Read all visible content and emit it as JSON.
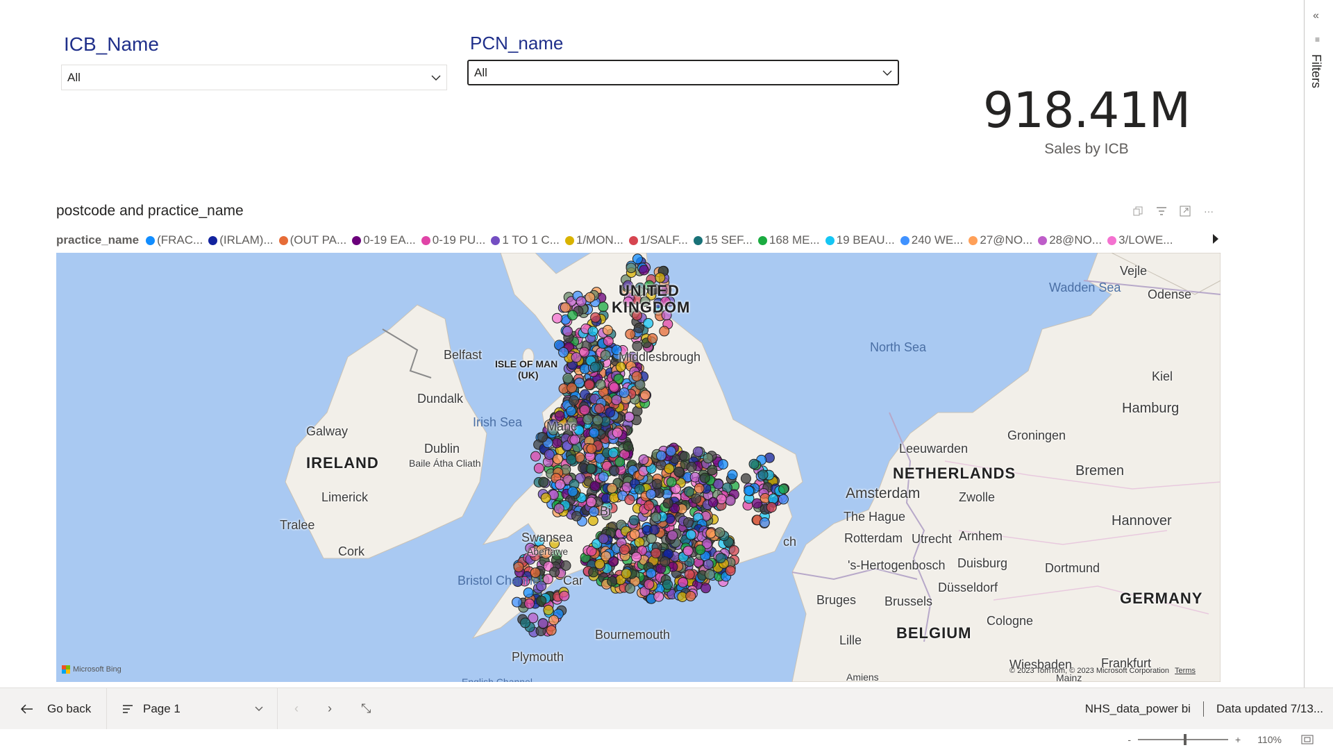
{
  "slicers": [
    {
      "title": "ICB_Name",
      "value": "All"
    },
    {
      "title": "PCN_name",
      "value": "All"
    }
  ],
  "card": {
    "value": "918.41M",
    "label": "Sales by ICB"
  },
  "map_visual": {
    "title": "postcode and practice_name",
    "legend_title": "practice_name",
    "legend_items": [
      {
        "label": "(FRAC...",
        "color": "#118dff"
      },
      {
        "label": "(IRLAM)...",
        "color": "#12239e"
      },
      {
        "label": "(OUT PA...",
        "color": "#e66c37"
      },
      {
        "label": "0-19 EA...",
        "color": "#6b007b"
      },
      {
        "label": "0-19 PU...",
        "color": "#e044a7"
      },
      {
        "label": "1 TO 1 C...",
        "color": "#744ec2"
      },
      {
        "label": "1/MON...",
        "color": "#d9b300"
      },
      {
        "label": "1/SALF...",
        "color": "#d64550"
      },
      {
        "label": "15 SEF...",
        "color": "#197278"
      },
      {
        "label": "168 ME...",
        "color": "#1aab40"
      },
      {
        "label": "19 BEAU...",
        "color": "#15c6f4"
      },
      {
        "label": "240 WE...",
        "color": "#4092ff"
      },
      {
        "label": "27@NO...",
        "color": "#ffa058"
      },
      {
        "label": "28@NO...",
        "color": "#be5dc9"
      },
      {
        "label": "3/LOWE...",
        "color": "#f472d0"
      }
    ],
    "map_labels": {
      "uk": "UNITED",
      "uk2": "KINGDOM",
      "ireland": "IRELAND",
      "netherlands": "NETHERLANDS",
      "belgium": "BELGIUM",
      "germany": "GERMANY",
      "isle_of_man": "ISLE OF MAN",
      "isle_of_man2": "(UK)",
      "north_sea": "North Sea",
      "irish_sea": "Irish Sea",
      "wadden_sea": "Wadden Sea",
      "bristol_channel": "Bristol Channel",
      "english_channel": "English Channel",
      "belfast": "Belfast",
      "dundalk": "Dundalk",
      "galway": "Galway",
      "dublin": "Dublin",
      "baile": "Baile Átha Cliath",
      "limerick": "Limerick",
      "tralee": "Tralee",
      "cork": "Cork",
      "middlesbrough": "Middlesbrough",
      "manchester": "Manc",
      "birmingham": "Bi",
      "swansea": "Swansea",
      "abertawe": "Abertawe",
      "cardiff": "Car",
      "bournemouth": "Bournemouth",
      "plymouth": "Plymouth",
      "norwich": "ch",
      "amsterdam": "Amsterdam",
      "the_hague": "The Hague",
      "rotterdam": "Rotterdam",
      "utrecht": "Utrecht",
      "hertogenbosch": "'s-Hertogenbosch",
      "arnhem": "Arnhem",
      "zwolle": "Zwolle",
      "leeuwarden": "Leeuwarden",
      "groningen": "Groningen",
      "bremen": "Bremen",
      "hamburg": "Hamburg",
      "kiel": "Kiel",
      "odense": "Odense",
      "vejle": "Vejle",
      "hannover": "Hannover",
      "duisburg": "Duisburg",
      "dortmund": "Dortmund",
      "dusseldorf": "Düsseldorf",
      "cologne": "Cologne",
      "bruges": "Bruges",
      "brussels": "Brussels",
      "lille": "Lille",
      "wiesbaden": "Wiesbaden",
      "frankfurt": "Frankfurt",
      "amiens": "Amiens",
      "mainz": "Mainz"
    },
    "bing_text": "Microsoft Bing",
    "copyright": "© 2023 TomTom, © 2023 Microsoft Corporation",
    "terms": "Terms"
  },
  "filters_pane": {
    "label": "Filters"
  },
  "bottom_bar": {
    "go_back": "Go back",
    "page": "Page 1",
    "report_name": "NHS_data_power bi",
    "data_updated": "Data updated 7/13..."
  },
  "status_bar": {
    "zoom_minus": "-",
    "zoom_plus": "+",
    "zoom": "110%"
  }
}
